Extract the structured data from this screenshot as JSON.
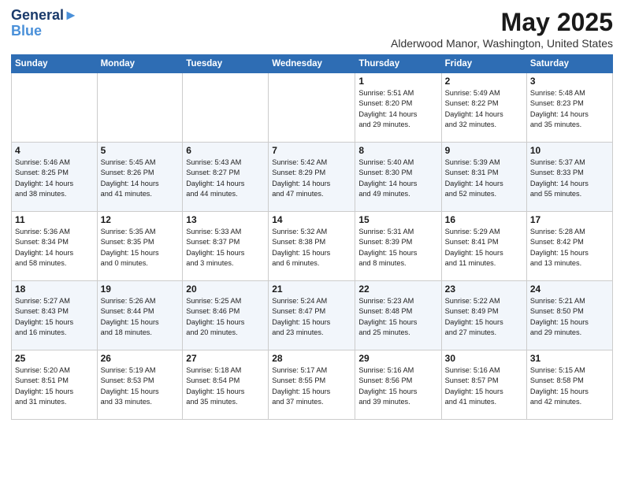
{
  "logo": {
    "line1": "General",
    "line2": "Blue"
  },
  "title": "May 2025",
  "location": "Alderwood Manor, Washington, United States",
  "days_of_week": [
    "Sunday",
    "Monday",
    "Tuesday",
    "Wednesday",
    "Thursday",
    "Friday",
    "Saturday"
  ],
  "weeks": [
    [
      {
        "day": "",
        "info": ""
      },
      {
        "day": "",
        "info": ""
      },
      {
        "day": "",
        "info": ""
      },
      {
        "day": "",
        "info": ""
      },
      {
        "day": "1",
        "info": "Sunrise: 5:51 AM\nSunset: 8:20 PM\nDaylight: 14 hours\nand 29 minutes."
      },
      {
        "day": "2",
        "info": "Sunrise: 5:49 AM\nSunset: 8:22 PM\nDaylight: 14 hours\nand 32 minutes."
      },
      {
        "day": "3",
        "info": "Sunrise: 5:48 AM\nSunset: 8:23 PM\nDaylight: 14 hours\nand 35 minutes."
      }
    ],
    [
      {
        "day": "4",
        "info": "Sunrise: 5:46 AM\nSunset: 8:25 PM\nDaylight: 14 hours\nand 38 minutes."
      },
      {
        "day": "5",
        "info": "Sunrise: 5:45 AM\nSunset: 8:26 PM\nDaylight: 14 hours\nand 41 minutes."
      },
      {
        "day": "6",
        "info": "Sunrise: 5:43 AM\nSunset: 8:27 PM\nDaylight: 14 hours\nand 44 minutes."
      },
      {
        "day": "7",
        "info": "Sunrise: 5:42 AM\nSunset: 8:29 PM\nDaylight: 14 hours\nand 47 minutes."
      },
      {
        "day": "8",
        "info": "Sunrise: 5:40 AM\nSunset: 8:30 PM\nDaylight: 14 hours\nand 49 minutes."
      },
      {
        "day": "9",
        "info": "Sunrise: 5:39 AM\nSunset: 8:31 PM\nDaylight: 14 hours\nand 52 minutes."
      },
      {
        "day": "10",
        "info": "Sunrise: 5:37 AM\nSunset: 8:33 PM\nDaylight: 14 hours\nand 55 minutes."
      }
    ],
    [
      {
        "day": "11",
        "info": "Sunrise: 5:36 AM\nSunset: 8:34 PM\nDaylight: 14 hours\nand 58 minutes."
      },
      {
        "day": "12",
        "info": "Sunrise: 5:35 AM\nSunset: 8:35 PM\nDaylight: 15 hours\nand 0 minutes."
      },
      {
        "day": "13",
        "info": "Sunrise: 5:33 AM\nSunset: 8:37 PM\nDaylight: 15 hours\nand 3 minutes."
      },
      {
        "day": "14",
        "info": "Sunrise: 5:32 AM\nSunset: 8:38 PM\nDaylight: 15 hours\nand 6 minutes."
      },
      {
        "day": "15",
        "info": "Sunrise: 5:31 AM\nSunset: 8:39 PM\nDaylight: 15 hours\nand 8 minutes."
      },
      {
        "day": "16",
        "info": "Sunrise: 5:29 AM\nSunset: 8:41 PM\nDaylight: 15 hours\nand 11 minutes."
      },
      {
        "day": "17",
        "info": "Sunrise: 5:28 AM\nSunset: 8:42 PM\nDaylight: 15 hours\nand 13 minutes."
      }
    ],
    [
      {
        "day": "18",
        "info": "Sunrise: 5:27 AM\nSunset: 8:43 PM\nDaylight: 15 hours\nand 16 minutes."
      },
      {
        "day": "19",
        "info": "Sunrise: 5:26 AM\nSunset: 8:44 PM\nDaylight: 15 hours\nand 18 minutes."
      },
      {
        "day": "20",
        "info": "Sunrise: 5:25 AM\nSunset: 8:46 PM\nDaylight: 15 hours\nand 20 minutes."
      },
      {
        "day": "21",
        "info": "Sunrise: 5:24 AM\nSunset: 8:47 PM\nDaylight: 15 hours\nand 23 minutes."
      },
      {
        "day": "22",
        "info": "Sunrise: 5:23 AM\nSunset: 8:48 PM\nDaylight: 15 hours\nand 25 minutes."
      },
      {
        "day": "23",
        "info": "Sunrise: 5:22 AM\nSunset: 8:49 PM\nDaylight: 15 hours\nand 27 minutes."
      },
      {
        "day": "24",
        "info": "Sunrise: 5:21 AM\nSunset: 8:50 PM\nDaylight: 15 hours\nand 29 minutes."
      }
    ],
    [
      {
        "day": "25",
        "info": "Sunrise: 5:20 AM\nSunset: 8:51 PM\nDaylight: 15 hours\nand 31 minutes."
      },
      {
        "day": "26",
        "info": "Sunrise: 5:19 AM\nSunset: 8:53 PM\nDaylight: 15 hours\nand 33 minutes."
      },
      {
        "day": "27",
        "info": "Sunrise: 5:18 AM\nSunset: 8:54 PM\nDaylight: 15 hours\nand 35 minutes."
      },
      {
        "day": "28",
        "info": "Sunrise: 5:17 AM\nSunset: 8:55 PM\nDaylight: 15 hours\nand 37 minutes."
      },
      {
        "day": "29",
        "info": "Sunrise: 5:16 AM\nSunset: 8:56 PM\nDaylight: 15 hours\nand 39 minutes."
      },
      {
        "day": "30",
        "info": "Sunrise: 5:16 AM\nSunset: 8:57 PM\nDaylight: 15 hours\nand 41 minutes."
      },
      {
        "day": "31",
        "info": "Sunrise: 5:15 AM\nSunset: 8:58 PM\nDaylight: 15 hours\nand 42 minutes."
      }
    ]
  ]
}
